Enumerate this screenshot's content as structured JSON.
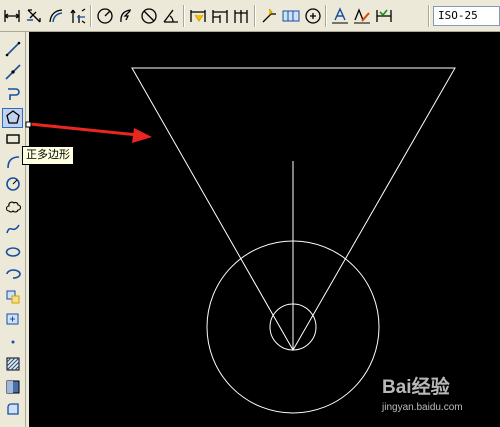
{
  "toolbar": {
    "dimstyle_value": "ISO-25",
    "buttons": [
      {
        "name": "linear-dim-icon"
      },
      {
        "name": "aligned-dim-icon"
      },
      {
        "name": "arc-length-dim-icon"
      },
      {
        "name": "ordinate-dim-icon"
      },
      {
        "name": "radius-dim-icon"
      },
      {
        "name": "jogged-dim-icon"
      },
      {
        "name": "diameter-dim-icon"
      },
      {
        "name": "angular-dim-icon"
      },
      {
        "name": "quick-dim-icon"
      },
      {
        "name": "baseline-dim-icon"
      },
      {
        "name": "continue-dim-icon"
      },
      {
        "name": "quick-leader-icon"
      },
      {
        "name": "tolerance-icon"
      },
      {
        "name": "center-mark-icon"
      },
      {
        "name": "dim-edit-icon"
      },
      {
        "name": "dim-text-edit-icon"
      },
      {
        "name": "dim-update-icon"
      }
    ]
  },
  "sidebar": {
    "tools": [
      {
        "name": "line-icon"
      },
      {
        "name": "construction-line-icon"
      },
      {
        "name": "polyline-icon"
      },
      {
        "name": "polygon-icon",
        "active": true
      },
      {
        "name": "rectangle-icon"
      },
      {
        "name": "arc-icon"
      },
      {
        "name": "circle-icon"
      },
      {
        "name": "revision-cloud-icon"
      },
      {
        "name": "spline-icon"
      },
      {
        "name": "ellipse-icon"
      },
      {
        "name": "ellipse-arc-icon"
      },
      {
        "name": "insert-block-icon"
      },
      {
        "name": "make-block-icon"
      },
      {
        "name": "point-icon"
      },
      {
        "name": "hatch-icon"
      },
      {
        "name": "gradient-icon"
      },
      {
        "name": "region-icon"
      }
    ]
  },
  "tooltip": {
    "text": "正多边形"
  },
  "watermark": {
    "logo": "Bai经验",
    "url": "jingyan.baidu.com"
  },
  "colors": {
    "canvas": "#000000",
    "geometry": "#ffffff",
    "arrow": "#e8281e",
    "chrome": "#ece9d8"
  }
}
